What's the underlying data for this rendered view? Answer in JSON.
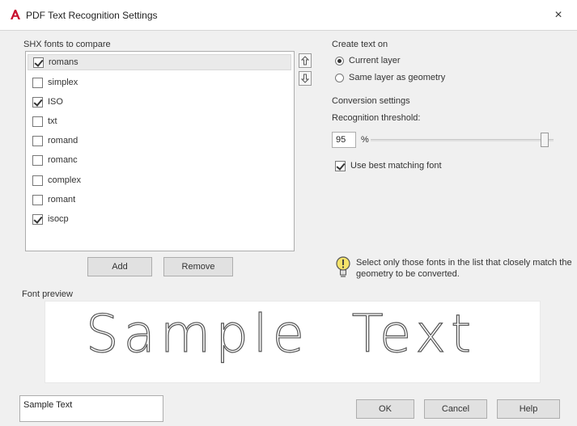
{
  "window": {
    "title": "PDF Text Recognition Settings",
    "close_glyph": "×",
    "app_icon": "autocad-a-icon",
    "accent_color": "#c8102e"
  },
  "fonts": {
    "label": "SHX fonts to compare",
    "items": [
      {
        "name": "romans",
        "checked": true
      },
      {
        "name": "simplex",
        "checked": false
      },
      {
        "name": "ISO",
        "checked": true
      },
      {
        "name": "txt",
        "checked": false
      },
      {
        "name": "romand",
        "checked": false
      },
      {
        "name": "romanc",
        "checked": false
      },
      {
        "name": "complex",
        "checked": false
      },
      {
        "name": "romant",
        "checked": false
      },
      {
        "name": "isocp",
        "checked": true
      }
    ],
    "add_label": "Add",
    "remove_label": "Remove"
  },
  "create_text_on": {
    "label": "Create text on",
    "options": [
      {
        "label": "Current layer",
        "selected": true
      },
      {
        "label": "Same layer as geometry",
        "selected": false
      }
    ]
  },
  "conversion": {
    "label": "Conversion settings",
    "threshold_label": "Recognition threshold:",
    "threshold_value": "95",
    "threshold_unit": "%",
    "threshold_fraction": 0.95,
    "use_best_label": "Use best matching font",
    "use_best_checked": true
  },
  "hint": {
    "icon": "lightbulb-icon",
    "text": "Select only those fonts in the list that closely match the geometry to be converted."
  },
  "preview": {
    "label": "Font preview",
    "text": "Sample  Text"
  },
  "sample_input_value": "Sample Text",
  "buttons": {
    "ok": "OK",
    "cancel": "Cancel",
    "help": "Help"
  }
}
